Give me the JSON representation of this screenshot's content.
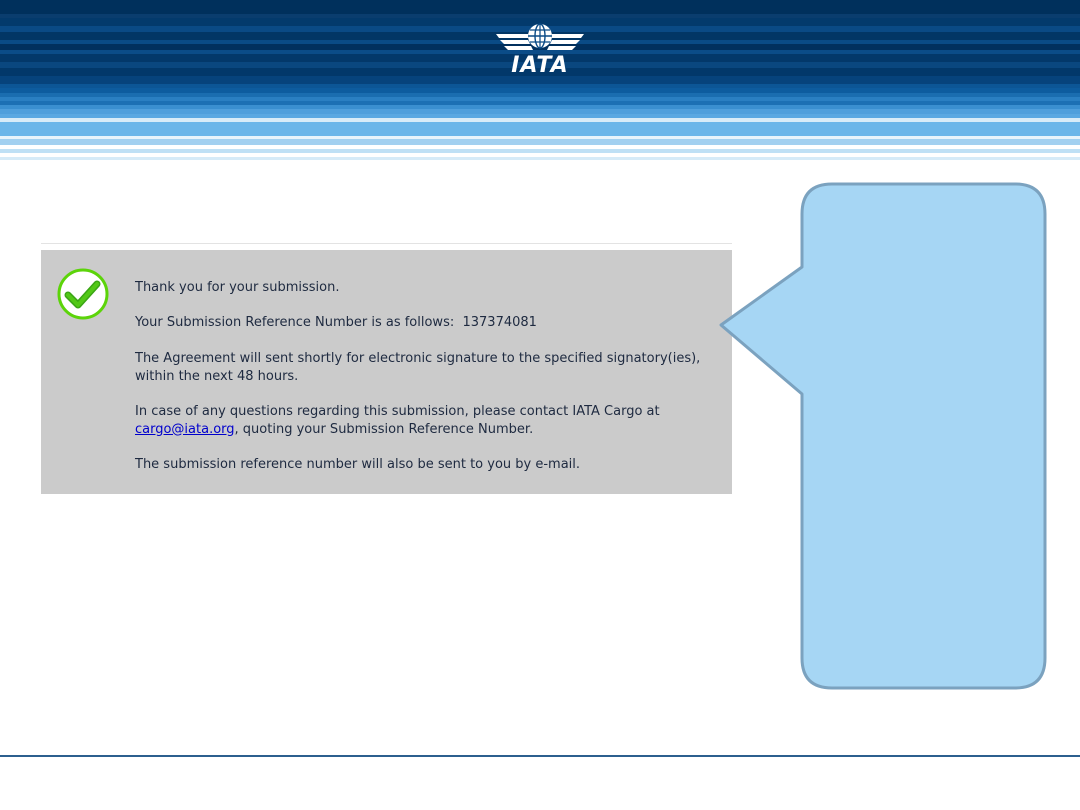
{
  "header": {
    "logo_text": "IATA",
    "colors": {
      "navy": "#01305e",
      "mid_blue": "#0b5b9e",
      "light_blue": "#6db7e8"
    }
  },
  "confirmation": {
    "status_icon": "check-icon",
    "status_color": "#5cd40a",
    "thank_you": "Thank you for your submission.",
    "reference_label": "Your Submission Reference Number is as follows:",
    "reference_number": "137374081",
    "agreement_line1": "The Agreement will sent shortly for electronic signature to the specified signatory(ies),",
    "agreement_line2": "within the next 48 hours.",
    "contact_line1": "In case of any questions regarding this submission, please contact IATA Cargo at",
    "contact_email": "cargo@iata.org",
    "contact_line2_rest": ", quoting your Submission Reference Number.",
    "email_notice": "The submission reference number will also be sent to you by e-mail."
  },
  "callout": {
    "fill_color": "#a6d6f4",
    "border_color": "#7ba2bf",
    "text": ""
  }
}
